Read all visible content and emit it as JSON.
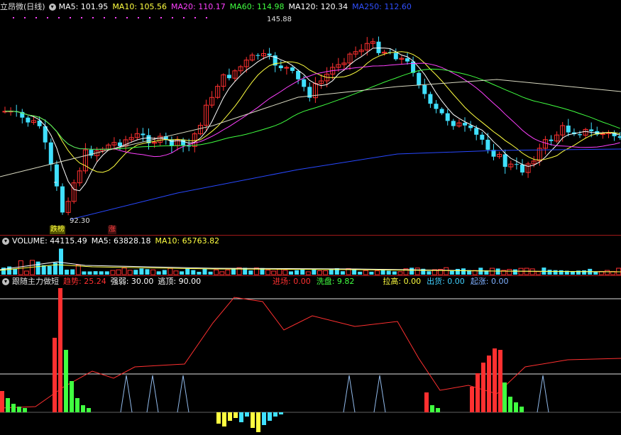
{
  "main_header": {
    "title": "立昂微(日线)",
    "items": [
      {
        "label": "MA5: 101.95",
        "color": "#ffffff"
      },
      {
        "label": "MA10: 105.56",
        "color": "#ffff40"
      },
      {
        "label": "MA20: 110.17",
        "color": "#ff40ff"
      },
      {
        "label": "MA60: 114.98",
        "color": "#40ff40"
      },
      {
        "label": "MA120: 120.34",
        "color": "#ffffff"
      },
      {
        "label": "MA250: 112.60",
        "color": "#3050ff"
      }
    ]
  },
  "main_annotations": {
    "high": "145.88",
    "low": "92.30",
    "tag_left": "跌榜",
    "tag_right": "涨"
  },
  "volume_header": {
    "items": [
      {
        "label": "VOLUME: 44115.49",
        "color": "#ffffff"
      },
      {
        "label": "MA5: 63828.18",
        "color": "#ffffff"
      },
      {
        "label": "MA10: 65763.82",
        "color": "#ffff40"
      }
    ]
  },
  "indicator_header": {
    "title": "跟随主力做短",
    "items_left": [
      {
        "label": "趋势: 25.24",
        "color": "#ff3030"
      },
      {
        "label": "强弱: 30.00",
        "color": "#ffffff"
      },
      {
        "label": "逃顶: 90.00",
        "color": "#ffffff"
      }
    ],
    "items_right": [
      {
        "label": "进场: 0.00",
        "color": "#ff3030"
      },
      {
        "label": "洗盘: 9.82",
        "color": "#40ff40"
      },
      {
        "label": "拉高: 0.00",
        "color": "#ffff40"
      },
      {
        "label": "出货: 0.00",
        "color": "#40d0ff"
      },
      {
        "label": "起涨: 0.00",
        "color": "#7fb0ff"
      }
    ]
  },
  "colors": {
    "up": "#ff3030",
    "down": "#40e0ff",
    "separator": "#a01818"
  }
}
